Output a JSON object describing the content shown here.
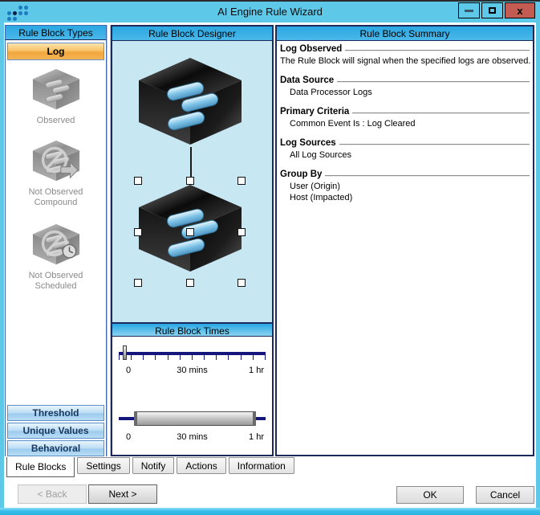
{
  "window": {
    "title": "AI Engine Rule Wizard",
    "controls": {
      "close_glyph": "x"
    }
  },
  "icons": {
    "logo": "logrhythm-dots-logo",
    "titlebar": [
      "minimize-icon",
      "maximize-icon",
      "close-icon"
    ],
    "type_items": [
      "cube-logs-icon",
      "cube-not-observed-arrow-icon",
      "cube-not-observed-clock-icon"
    ],
    "designer": [
      "rule-block-cube-icon",
      "rule-block-cube-selected-icon"
    ]
  },
  "panels": {
    "types": {
      "header": "Rule Block Types",
      "log_button": "Log",
      "items": [
        {
          "label": "Observed"
        },
        {
          "label": "Not Observed Compound"
        },
        {
          "label": "Not Observed Scheduled"
        }
      ],
      "categories": [
        "Threshold",
        "Unique Values",
        "Behavioral"
      ]
    },
    "designer": {
      "header": "Rule Block Designer"
    },
    "times": {
      "header": "Rule Block Times",
      "slider1": {
        "start": "0",
        "mid": "30 mins",
        "end": "1 hr",
        "value": "0"
      },
      "slider2": {
        "start": "0",
        "mid": "30 mins",
        "end": "1 hr",
        "range": "0 to 1 hr"
      }
    },
    "summary": {
      "header": "Rule Block Summary",
      "sections": [
        {
          "title": "Log Observed",
          "line1": "The Rule Block will signal when the specified logs are observed."
        },
        {
          "title": "Data Source",
          "line1": "Data Processor Logs"
        },
        {
          "title": "Primary Criteria",
          "line1": "Common Event Is : Log Cleared"
        },
        {
          "title": "Log Sources",
          "line1": "All Log Sources"
        },
        {
          "title": "Group By",
          "line1": "User (Origin)",
          "line2": "Host (Impacted)"
        }
      ]
    }
  },
  "tabs": {
    "t0": "Rule Blocks",
    "t1": "Settings",
    "t2": "Notify",
    "t3": "Actions",
    "t4": "Information"
  },
  "buttons": {
    "back": "< Back",
    "next": "Next >",
    "ok": "OK",
    "cancel": "Cancel"
  },
  "colors": {
    "titlebar": "#5EC8E9",
    "header_blue": "#2AA7E2",
    "accent_orange": "#F2A73E",
    "panel_border_navy": "#1B2A5A",
    "close_red": "#C25B52",
    "canvas_blue": "#C7E7F3",
    "slider_track_navy": "#15157E"
  }
}
